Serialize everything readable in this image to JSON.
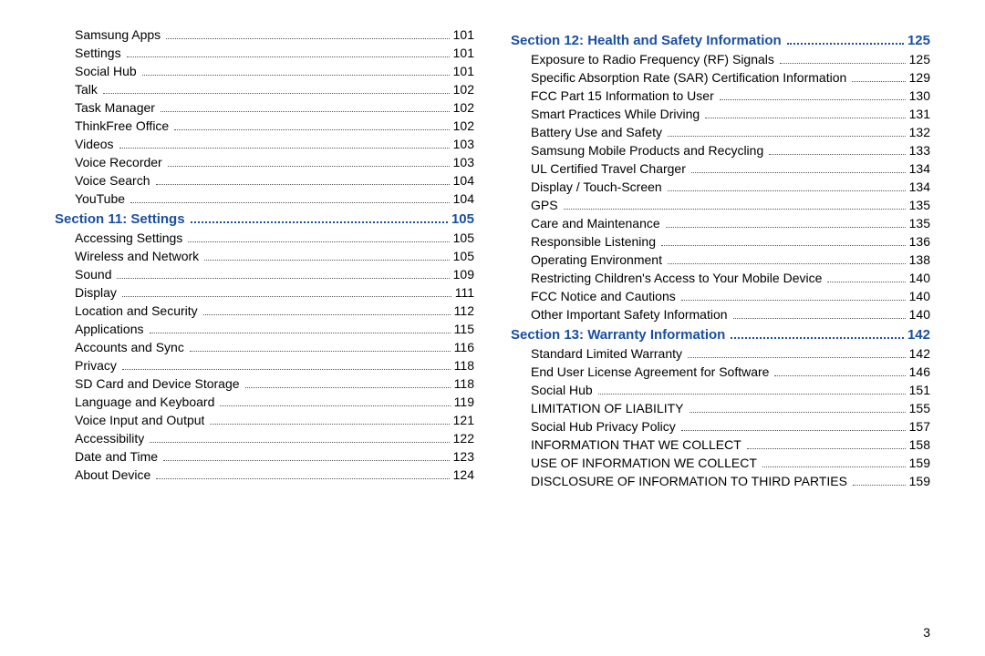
{
  "page_number": "3",
  "columns": [
    [
      {
        "type": "entry",
        "label": "Samsung Apps",
        "page": "101"
      },
      {
        "type": "entry",
        "label": "Settings",
        "page": "101"
      },
      {
        "type": "entry",
        "label": "Social Hub",
        "page": "101"
      },
      {
        "type": "entry",
        "label": "Talk",
        "page": "102"
      },
      {
        "type": "entry",
        "label": "Task Manager",
        "page": "102"
      },
      {
        "type": "entry",
        "label": "ThinkFree Office",
        "page": "102"
      },
      {
        "type": "entry",
        "label": "Videos",
        "page": "103"
      },
      {
        "type": "entry",
        "label": "Voice Recorder",
        "page": "103"
      },
      {
        "type": "entry",
        "label": "Voice Search",
        "page": "104"
      },
      {
        "type": "entry",
        "label": "YouTube",
        "page": "104"
      },
      {
        "type": "section",
        "label": "Section 11:  Settings",
        "page": "105"
      },
      {
        "type": "entry",
        "label": "Accessing Settings",
        "page": "105"
      },
      {
        "type": "entry",
        "label": "Wireless and Network",
        "page": "105"
      },
      {
        "type": "entry",
        "label": "Sound",
        "page": "109"
      },
      {
        "type": "entry",
        "label": "Display",
        "page": "111"
      },
      {
        "type": "entry",
        "label": "Location and Security",
        "page": "112"
      },
      {
        "type": "entry",
        "label": "Applications",
        "page": "115"
      },
      {
        "type": "entry",
        "label": "Accounts and Sync",
        "page": "116"
      },
      {
        "type": "entry",
        "label": "Privacy",
        "page": "118"
      },
      {
        "type": "entry",
        "label": "SD Card and Device Storage",
        "page": "118"
      },
      {
        "type": "entry",
        "label": "Language and Keyboard",
        "page": "119"
      },
      {
        "type": "entry",
        "label": "Voice Input and Output",
        "page": "121"
      },
      {
        "type": "entry",
        "label": "Accessibility",
        "page": "122"
      },
      {
        "type": "entry",
        "label": "Date and Time",
        "page": "123"
      },
      {
        "type": "entry",
        "label": "About Device",
        "page": "124"
      }
    ],
    [
      {
        "type": "section",
        "label": "Section 12:  Health and Safety Information",
        "page": "125"
      },
      {
        "type": "entry",
        "label": "Exposure to Radio Frequency (RF) Signals",
        "page": "125"
      },
      {
        "type": "entry",
        "label": "Specific Absorption Rate (SAR) Certification Information",
        "page": "129"
      },
      {
        "type": "entry",
        "label": "FCC Part 15 Information to User",
        "page": "130"
      },
      {
        "type": "entry",
        "label": "Smart Practices While Driving",
        "page": "131"
      },
      {
        "type": "entry",
        "label": "Battery Use and Safety",
        "page": "132"
      },
      {
        "type": "entry",
        "label": "Samsung Mobile Products and Recycling",
        "page": "133"
      },
      {
        "type": "entry",
        "label": "UL Certified Travel Charger",
        "page": "134"
      },
      {
        "type": "entry",
        "label": "Display / Touch-Screen",
        "page": "134"
      },
      {
        "type": "entry",
        "label": "GPS",
        "page": "135"
      },
      {
        "type": "entry",
        "label": "Care and Maintenance",
        "page": "135"
      },
      {
        "type": "entry",
        "label": "Responsible Listening",
        "page": "136"
      },
      {
        "type": "entry",
        "label": "Operating Environment",
        "page": "138"
      },
      {
        "type": "entry",
        "label": "Restricting Children's Access to Your Mobile Device",
        "page": "140"
      },
      {
        "type": "entry",
        "label": "FCC Notice and Cautions",
        "page": "140"
      },
      {
        "type": "entry",
        "label": "Other Important Safety Information",
        "page": "140"
      },
      {
        "type": "section",
        "label": "Section 13:  Warranty Information",
        "page": "142"
      },
      {
        "type": "entry",
        "label": "Standard Limited Warranty",
        "page": "142"
      },
      {
        "type": "entry",
        "label": "End User License Agreement for Software",
        "page": "146"
      },
      {
        "type": "entry",
        "label": "Social Hub",
        "page": "151"
      },
      {
        "type": "entry",
        "label": "LIMITATION OF LIABILITY",
        "page": "155"
      },
      {
        "type": "entry",
        "label": "Social Hub Privacy Policy",
        "page": "157"
      },
      {
        "type": "entry",
        "label": "INFORMATION THAT WE COLLECT",
        "page": "158"
      },
      {
        "type": "entry",
        "label": "USE OF INFORMATION WE COLLECT",
        "page": "159"
      },
      {
        "type": "entry",
        "label": "DISCLOSURE OF INFORMATION TO THIRD PARTIES",
        "page": "159"
      }
    ]
  ]
}
